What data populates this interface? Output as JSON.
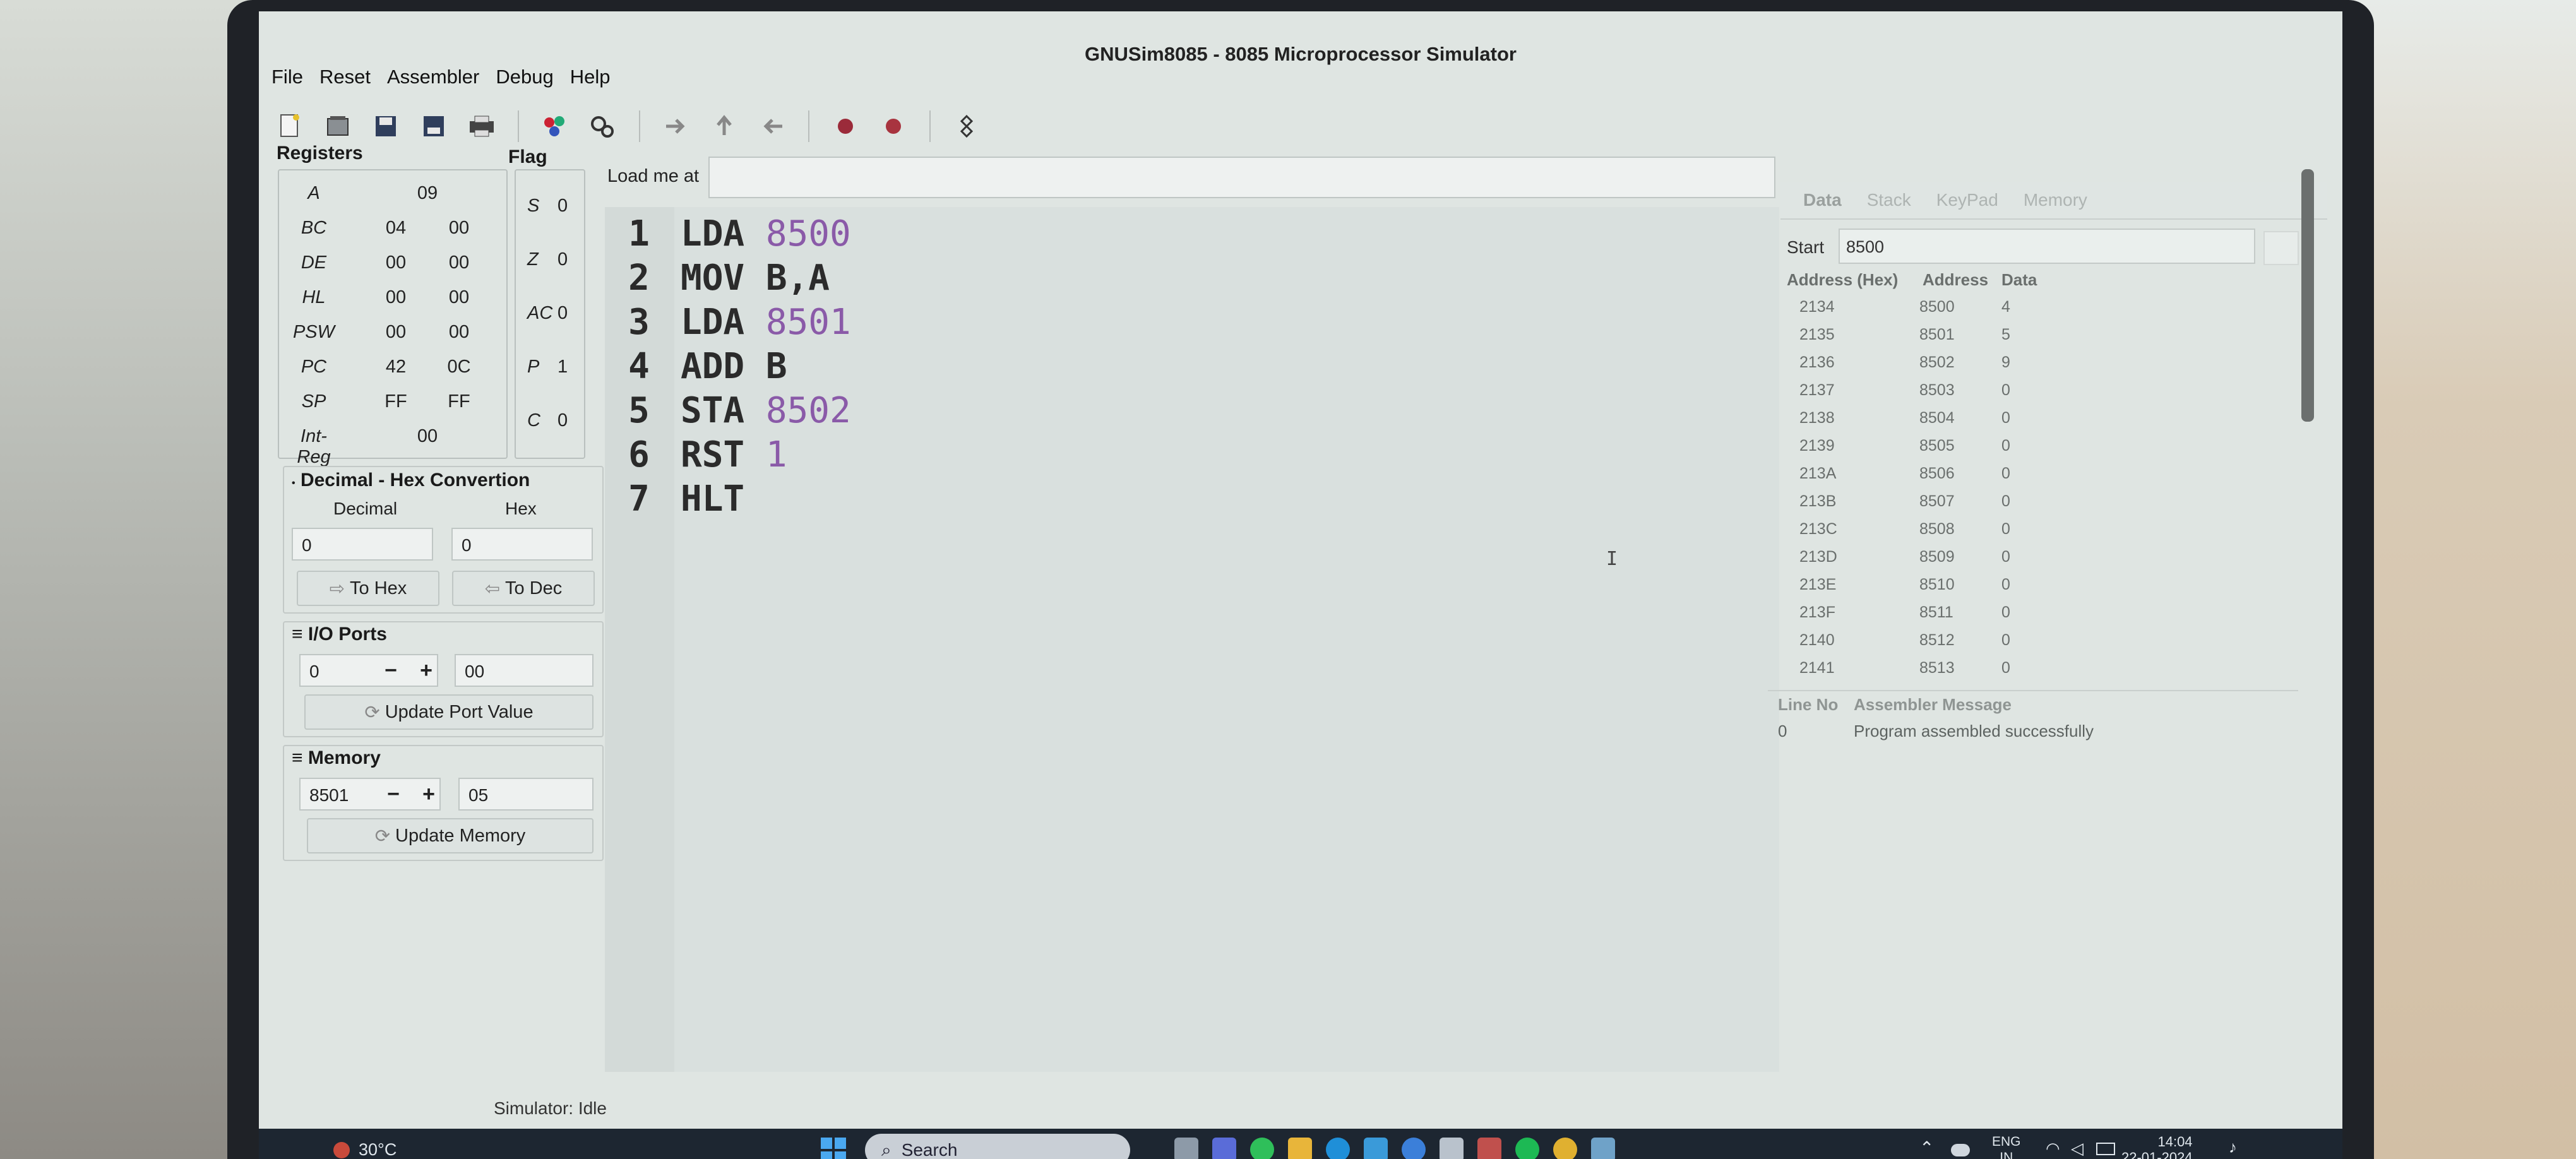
{
  "window": {
    "title": "GNUSim8085 - 8085 Microprocessor Simulator"
  },
  "menu": [
    "File",
    "Reset",
    "Assembler",
    "Debug",
    "Help"
  ],
  "registers": {
    "title": "Registers",
    "rows": [
      {
        "name": "A",
        "single": "09"
      },
      {
        "name": "BC",
        "hi": "04",
        "lo": "00"
      },
      {
        "name": "DE",
        "hi": "00",
        "lo": "00"
      },
      {
        "name": "HL",
        "hi": "00",
        "lo": "00"
      },
      {
        "name": "PSW",
        "hi": "00",
        "lo": "00"
      },
      {
        "name": "PC",
        "hi": "42",
        "lo": "0C"
      },
      {
        "name": "SP",
        "hi": "FF",
        "lo": "FF"
      },
      {
        "name": "Int-Reg",
        "single": "00"
      }
    ]
  },
  "flags": {
    "title": "Flag",
    "rows": [
      {
        "name": "S",
        "value": "0"
      },
      {
        "name": "Z",
        "value": "0"
      },
      {
        "name": "AC",
        "value": "0"
      },
      {
        "name": "P",
        "value": "1"
      },
      {
        "name": "C",
        "value": "0"
      }
    ]
  },
  "converter": {
    "title": "Decimal - Hex Convertion",
    "decimal_label": "Decimal",
    "hex_label": "Hex",
    "decimal_value": "0",
    "hex_value": "0",
    "to_hex": "To Hex",
    "to_dec": "To Dec"
  },
  "io_ports": {
    "title": "I/O Ports",
    "port": "0",
    "value": "00",
    "minus": "−",
    "plus": "+",
    "update": "Update Port Value"
  },
  "memory_panel": {
    "title": "Memory",
    "address": "8501",
    "value": "05",
    "minus": "−",
    "plus": "+",
    "update": "Update Memory"
  },
  "editor": {
    "load_label": "Load me at",
    "load_value": "",
    "lines": [
      {
        "n": "1",
        "op": "LDA ",
        "arg": "8500",
        "arg_is_num": true
      },
      {
        "n": "2",
        "op": "MOV B,A",
        "arg": "",
        "arg_is_num": false
      },
      {
        "n": "3",
        "op": "LDA ",
        "arg": "8501",
        "arg_is_num": true
      },
      {
        "n": "4",
        "op": "ADD B",
        "arg": "",
        "arg_is_num": false
      },
      {
        "n": "5",
        "op": "STA ",
        "arg": "8502",
        "arg_is_num": true
      },
      {
        "n": "6",
        "op": "RST ",
        "arg": "1",
        "arg_is_num": true
      },
      {
        "n": "7",
        "op": "HLT",
        "arg": "",
        "arg_is_num": false
      }
    ]
  },
  "right_pane": {
    "tabs": [
      "Data",
      "Stack",
      "KeyPad",
      "Memory"
    ],
    "start_label": "Start",
    "start_value": "8500",
    "headers": [
      "Address (Hex)",
      "Address",
      "Data"
    ],
    "rows": [
      [
        "2134",
        "8500",
        "4"
      ],
      [
        "2135",
        "8501",
        "5"
      ],
      [
        "2136",
        "8502",
        "9"
      ],
      [
        "2137",
        "8503",
        "0"
      ],
      [
        "2138",
        "8504",
        "0"
      ],
      [
        "2139",
        "8505",
        "0"
      ],
      [
        "213A",
        "8506",
        "0"
      ],
      [
        "213B",
        "8507",
        "0"
      ],
      [
        "213C",
        "8508",
        "0"
      ],
      [
        "213D",
        "8509",
        "0"
      ],
      [
        "213E",
        "8510",
        "0"
      ],
      [
        "213F",
        "8511",
        "0"
      ],
      [
        "2140",
        "8512",
        "0"
      ],
      [
        "2141",
        "8513",
        "0"
      ]
    ]
  },
  "messages": {
    "headers": [
      "Line No",
      "Assembler Message"
    ],
    "line": "0",
    "text": "Program assembled successfully"
  },
  "status": "Simulator: Idle",
  "taskbar": {
    "weather": "30°C",
    "search": "Search",
    "lang1": "ENG",
    "lang2": "IN",
    "time": "14:04",
    "date": "22-01-2024"
  },
  "colors": {
    "number_token": "#8a5aa8",
    "taskbar_bg": "#1d2631",
    "window_bg": "#dfe5e2"
  }
}
